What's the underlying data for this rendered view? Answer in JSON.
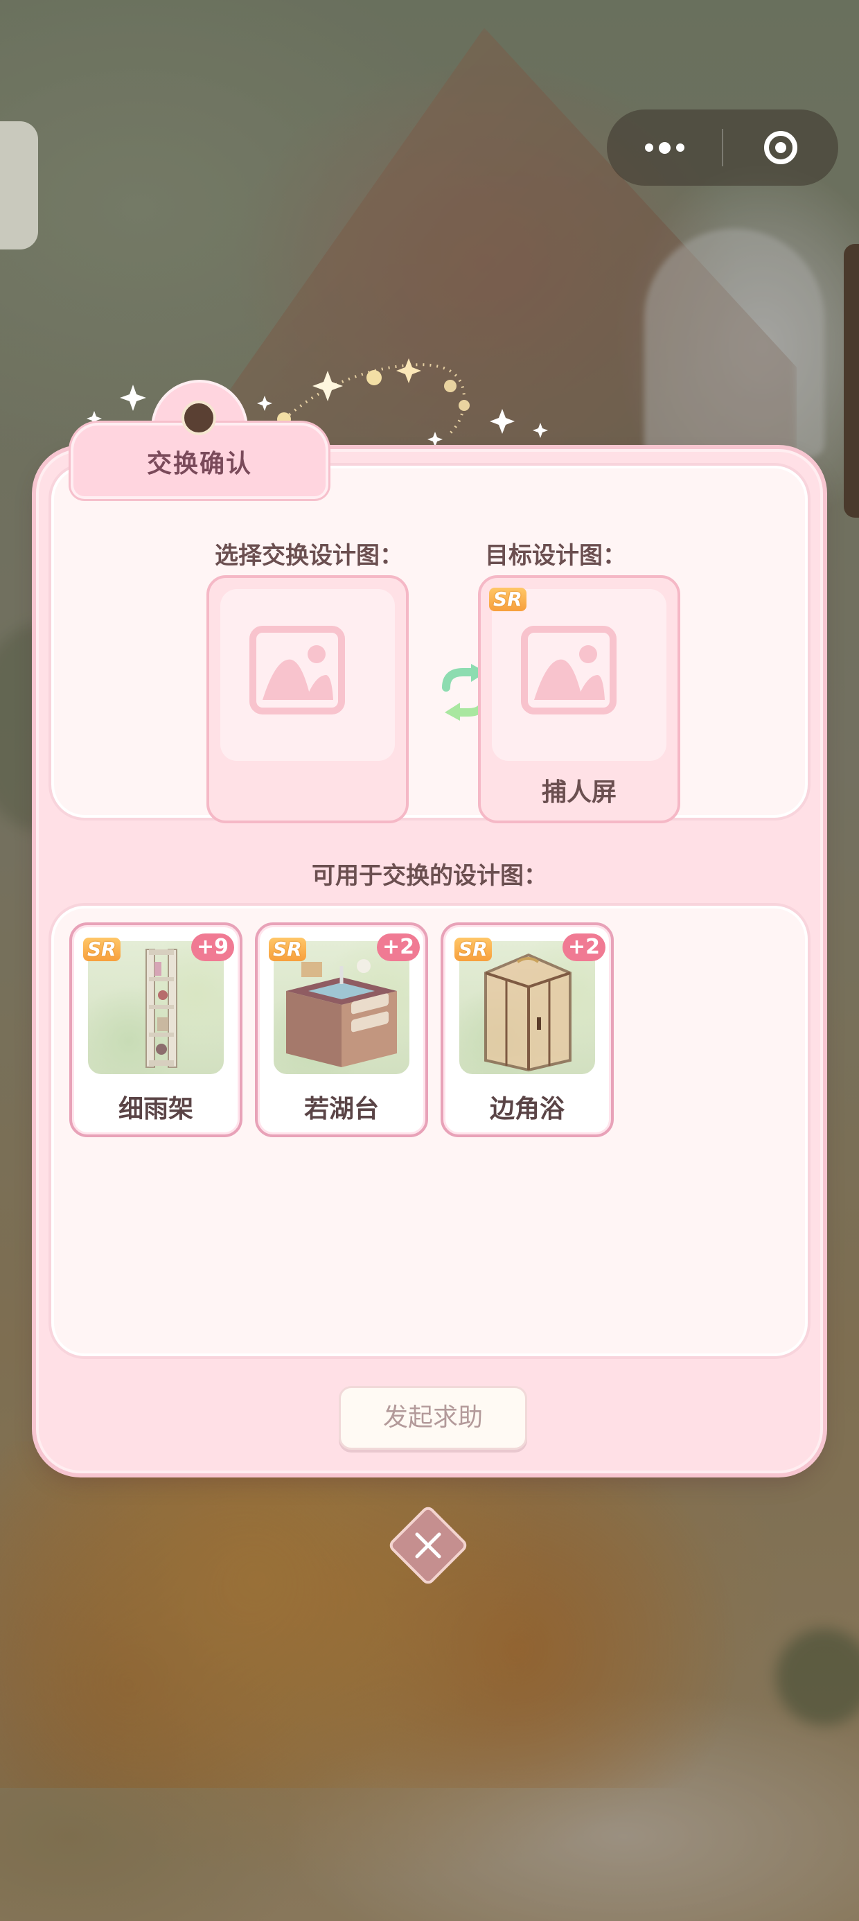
{
  "dialog": {
    "title": "交换确认",
    "select_label": "选择交换设计图：",
    "target_label": "目标设计图：",
    "target_slot": {
      "rarity": "SR",
      "name": "捕人屏"
    },
    "available_label": "可用于交换的设计图：",
    "items": [
      {
        "rarity": "SR",
        "count": "+9",
        "name": "细雨架"
      },
      {
        "rarity": "SR",
        "count": "+2",
        "name": "若湖台"
      },
      {
        "rarity": "SR",
        "count": "+2",
        "name": "边角浴"
      }
    ],
    "help_button": "发起求助"
  },
  "colors": {
    "dialog_bg": "#ffe0e6",
    "panel_bg": "#fff5f5",
    "accent_pink": "#f07a93",
    "sr_badge": "#f79f3c"
  }
}
